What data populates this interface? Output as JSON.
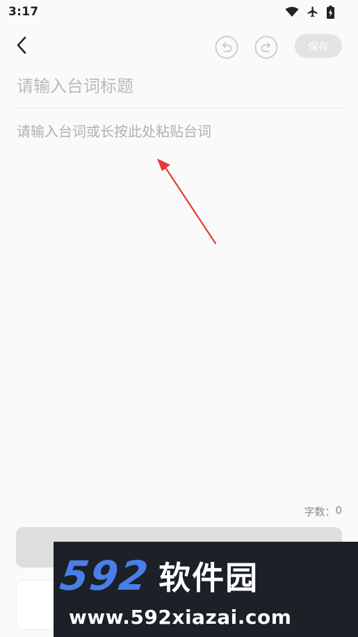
{
  "status_bar": {
    "time": "3:17",
    "icons": [
      "wifi-icon",
      "airplane-icon",
      "battery-charging-icon"
    ]
  },
  "toolbar": {
    "back_icon": "chevron-left-icon",
    "undo_icon": "undo-icon",
    "redo_icon": "redo-icon",
    "save_label": "保存"
  },
  "editor": {
    "title_placeholder": "请输入台词标题",
    "title_value": "",
    "content_placeholder": "请输入台词或长按此处粘贴台词",
    "content_value": ""
  },
  "word_count": {
    "label": "字数：",
    "value": "0"
  },
  "watermark": {
    "number": "592",
    "name": "软件园",
    "url": "www.592xiazai.com"
  },
  "colors": {
    "background": "#fafafa",
    "save_button_bg": "#e3e3e3",
    "arrow": "#e53935",
    "watermark_bg": "#1c2027",
    "watermark_accent": "#4a7ee8"
  }
}
